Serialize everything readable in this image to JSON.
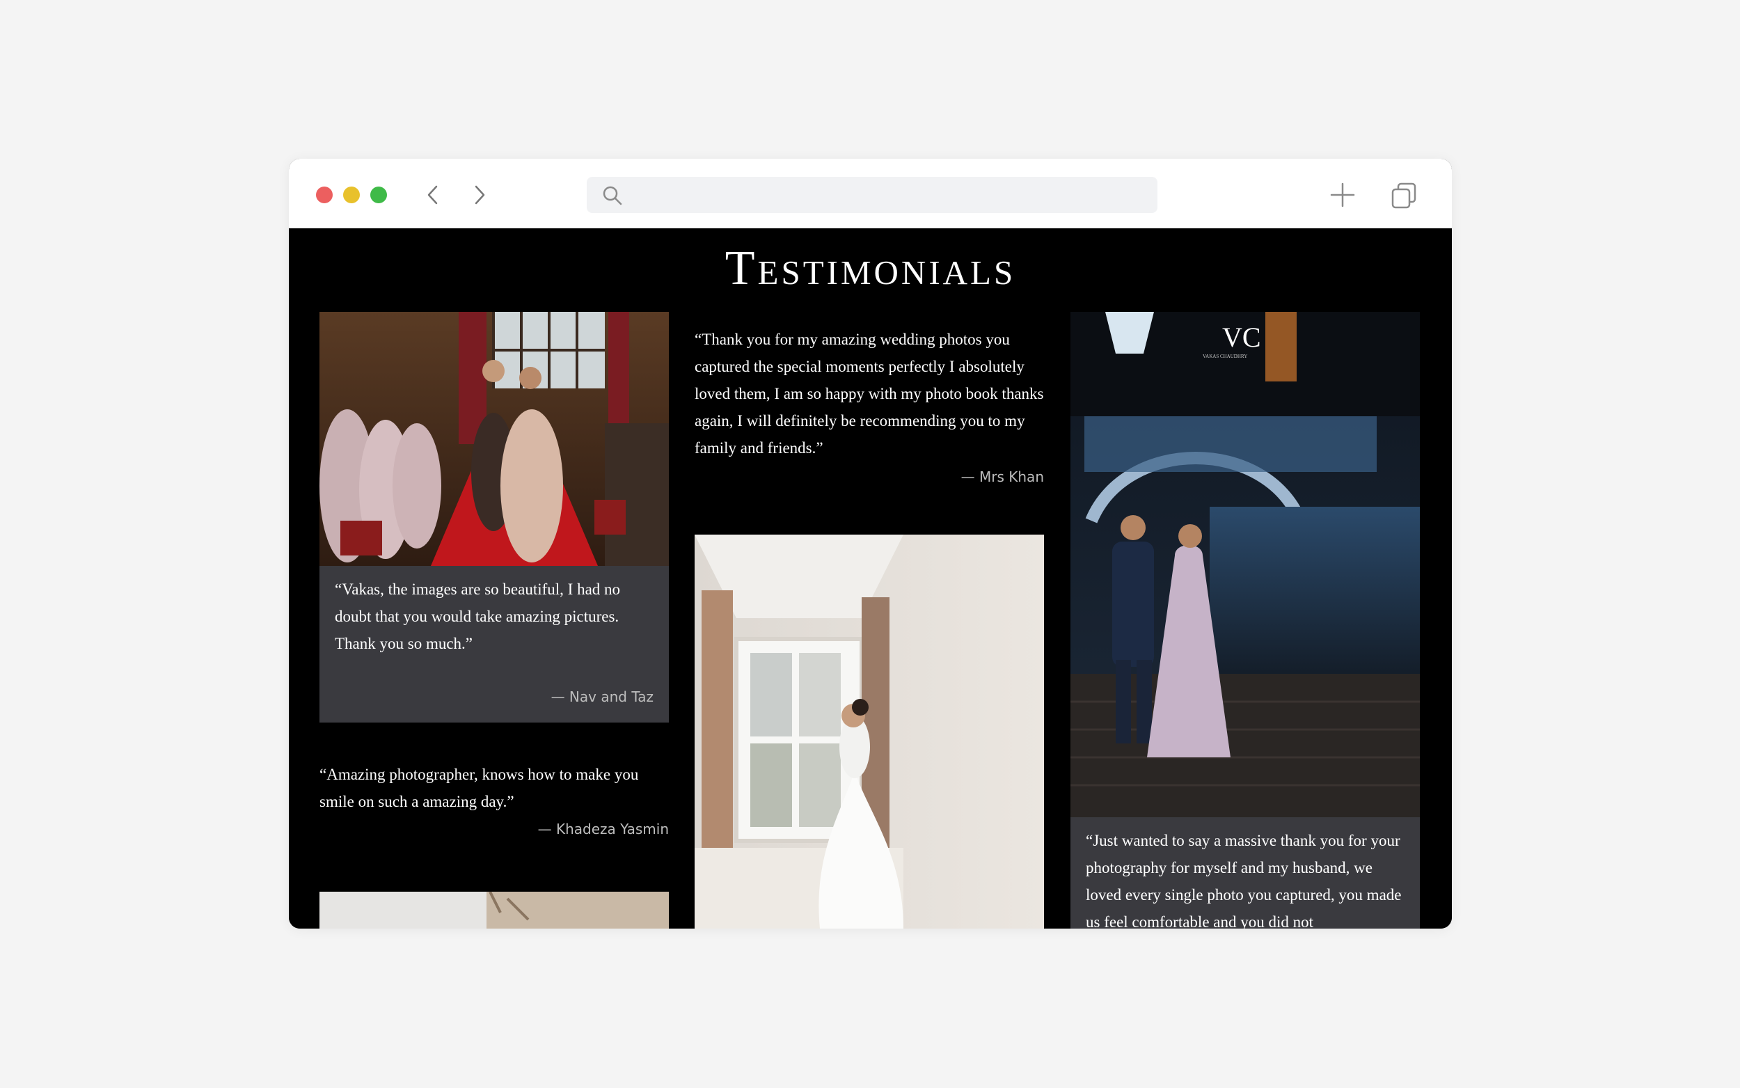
{
  "browser": {
    "search_placeholder": ""
  },
  "page": {
    "title": "Testimonials"
  },
  "testimonials": [
    {
      "quote": "“Vakas, the images are so beautiful, I had no doubt that you would take amazing pictures. Thank you so much.”",
      "author": "— Nav and Taz"
    },
    {
      "quote": "“Amazing photographer, knows how to make you smile on such a amazing day.”",
      "author": "— Khadeza Yasmin"
    },
    {
      "quote": "“Thank you for my amazing wedding photos you captured the special moments perfectly I absolutely loved them, I am so happy with my photo book thanks again, I will definitely be recommending you to my family and friends.”",
      "author": "— Mrs Khan"
    },
    {
      "quote": "“Just wanted to say a massive thank you for your photography for myself and my husband, we loved every single photo you captured, you made us feel comfortable and you did not",
      "author": ""
    }
  ],
  "photos": {
    "logo_text": "VC",
    "logo_subtext": "VAKAS CHAUDHRY"
  },
  "colors": {
    "background": "#000000",
    "card": "#3a3a3f",
    "page_bg": "#f4f4f4"
  }
}
